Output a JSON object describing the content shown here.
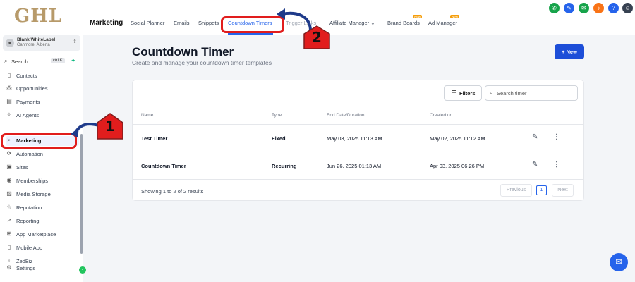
{
  "logo": "GHL",
  "account": {
    "name": "Blank WhiteLabel",
    "location": "Canmore, Alberta"
  },
  "search": {
    "label": "Search",
    "shortcut": "ctrl K"
  },
  "sidebar": {
    "items": [
      {
        "label": "Contacts",
        "icon": "contacts-icon"
      },
      {
        "label": "Opportunities",
        "icon": "opportunities-icon"
      },
      {
        "label": "Payments",
        "icon": "payments-icon"
      },
      {
        "label": "AI Agents",
        "icon": "ai-agents-icon"
      },
      {
        "label": "Marketing",
        "icon": "send-icon"
      },
      {
        "label": "Automation",
        "icon": "automation-icon"
      },
      {
        "label": "Sites",
        "icon": "sites-icon"
      },
      {
        "label": "Memberships",
        "icon": "memberships-icon"
      },
      {
        "label": "Media Storage",
        "icon": "media-icon"
      },
      {
        "label": "Reputation",
        "icon": "star-icon"
      },
      {
        "label": "Reporting",
        "icon": "reporting-icon"
      },
      {
        "label": "App Marketplace",
        "icon": "grid-icon"
      },
      {
        "label": "Mobile App",
        "icon": "mobile-icon"
      },
      {
        "label": "ZedBiz",
        "icon": "zedbiz-icon"
      },
      {
        "label": "Settings",
        "icon": "gear-icon"
      }
    ]
  },
  "topbar": {
    "title": "Marketing",
    "tabs": [
      {
        "label": "Social Planner"
      },
      {
        "label": "Emails"
      },
      {
        "label": "Snippets"
      },
      {
        "label": "Countdown Timers"
      },
      {
        "label": "Trigger Links"
      },
      {
        "label": "Affiliate Manager"
      },
      {
        "label": "Brand Boards",
        "badge": "New"
      },
      {
        "label": "Ad Manager",
        "badge": "New"
      }
    ]
  },
  "page": {
    "title": "Countdown Timer",
    "subtitle": "Create and manage your countdown timer templates",
    "new_button": "New",
    "filters_label": "Filters",
    "search_placeholder": "Search timer"
  },
  "table": {
    "headers": [
      "Name",
      "Type",
      "End Date/Duration",
      "Created on"
    ],
    "rows": [
      {
        "name": "Test Timer",
        "type": "Fixed",
        "end": "May 03, 2025 11:13 AM",
        "created": "May 02, 2025 11:12 AM"
      },
      {
        "name": "Countdown Timer",
        "type": "Recurring",
        "end": "Jun 26, 2025 01:13 AM",
        "created": "Apr 03, 2025 06:26 PM"
      }
    ],
    "showing": "Showing 1 to 2 of 2 results",
    "pagination": {
      "prev": "Previous",
      "current": "1",
      "next": "Next"
    }
  },
  "annotations": {
    "step1": "1",
    "step2": "2"
  },
  "colors": {
    "accent": "#2563eb",
    "annotation": "#e11d1d",
    "arrow": "#1e3a8a"
  }
}
